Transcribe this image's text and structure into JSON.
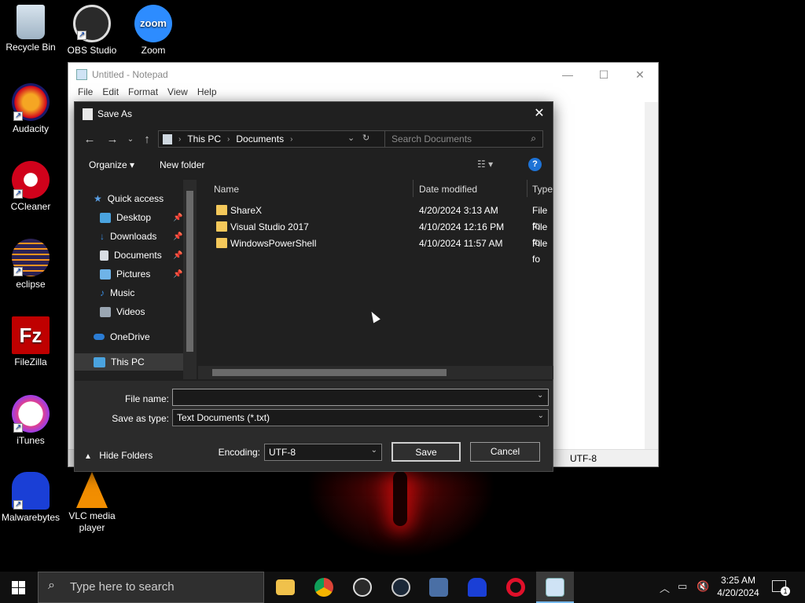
{
  "desktop": {
    "icons": [
      {
        "label": "Recycle Bin",
        "icon": "recycle-bin-icon"
      },
      {
        "label": "OBS Studio",
        "icon": "obs-icon"
      },
      {
        "label": "Zoom",
        "icon": "zoom-icon"
      },
      {
        "label": "Audacity",
        "icon": "audacity-icon"
      },
      {
        "label": "CCleaner",
        "icon": "ccleaner-icon"
      },
      {
        "label": "eclipse",
        "icon": "eclipse-icon"
      },
      {
        "label": "FileZilla",
        "icon": "filezilla-icon"
      },
      {
        "label": "iTunes",
        "icon": "itunes-icon"
      },
      {
        "label": "Malwarebytes",
        "icon": "malwarebytes-icon"
      },
      {
        "label": "VLC media player",
        "icon": "vlc-icon"
      }
    ],
    "zoom_icon_text": "zoom",
    "filezilla_icon_text": "Fz"
  },
  "notepad": {
    "title": "Untitled - Notepad",
    "menu": [
      "File",
      "Edit",
      "Format",
      "View",
      "Help"
    ],
    "status_encoding": "UTF-8"
  },
  "dialog": {
    "title": "Save As",
    "breadcrumb": [
      "This PC",
      "Documents"
    ],
    "search_placeholder": "Search Documents",
    "toolbar": {
      "organize": "Organize ▾",
      "new_folder": "New folder",
      "help": "?"
    },
    "nav": [
      {
        "label": "Quick access",
        "icon": "star-icon",
        "pinned": false
      },
      {
        "label": "Desktop",
        "icon": "desktop-icon",
        "pinned": true
      },
      {
        "label": "Downloads",
        "icon": "download-icon",
        "pinned": true
      },
      {
        "label": "Documents",
        "icon": "documents-icon",
        "pinned": true
      },
      {
        "label": "Pictures",
        "icon": "pictures-icon",
        "pinned": true
      },
      {
        "label": "Music",
        "icon": "music-icon",
        "pinned": false
      },
      {
        "label": "Videos",
        "icon": "videos-icon",
        "pinned": false
      },
      {
        "label": "OneDrive",
        "icon": "cloud-icon",
        "pinned": false
      },
      {
        "label": "This PC",
        "icon": "computer-icon",
        "pinned": false
      }
    ],
    "columns": {
      "name": "Name",
      "date": "Date modified",
      "type": "Type"
    },
    "files": [
      {
        "name": "ShareX",
        "date": "4/20/2024 3:13 AM",
        "type": "File fo"
      },
      {
        "name": "Visual Studio 2017",
        "date": "4/10/2024 12:16 PM",
        "type": "File fo"
      },
      {
        "name": "WindowsPowerShell",
        "date": "4/10/2024 11:57 AM",
        "type": "File fo"
      }
    ],
    "file_name_label": "File name:",
    "file_name_value": "",
    "save_type_label": "Save as type:",
    "save_type_value": "Text Documents (*.txt)",
    "hide_folders": "Hide Folders",
    "encoding_label": "Encoding:",
    "encoding_value": "UTF-8",
    "save": "Save",
    "cancel": "Cancel"
  },
  "taskbar": {
    "search_placeholder": "Type here to search",
    "pinned": [
      "file-explorer-icon",
      "chrome-icon",
      "obs-icon",
      "steam-icon",
      "app-icon",
      "malwarebytes-icon",
      "opera-icon",
      "notepad-icon"
    ],
    "time": "3:25 AM",
    "date": "4/20/2024",
    "notification_count": "1"
  }
}
